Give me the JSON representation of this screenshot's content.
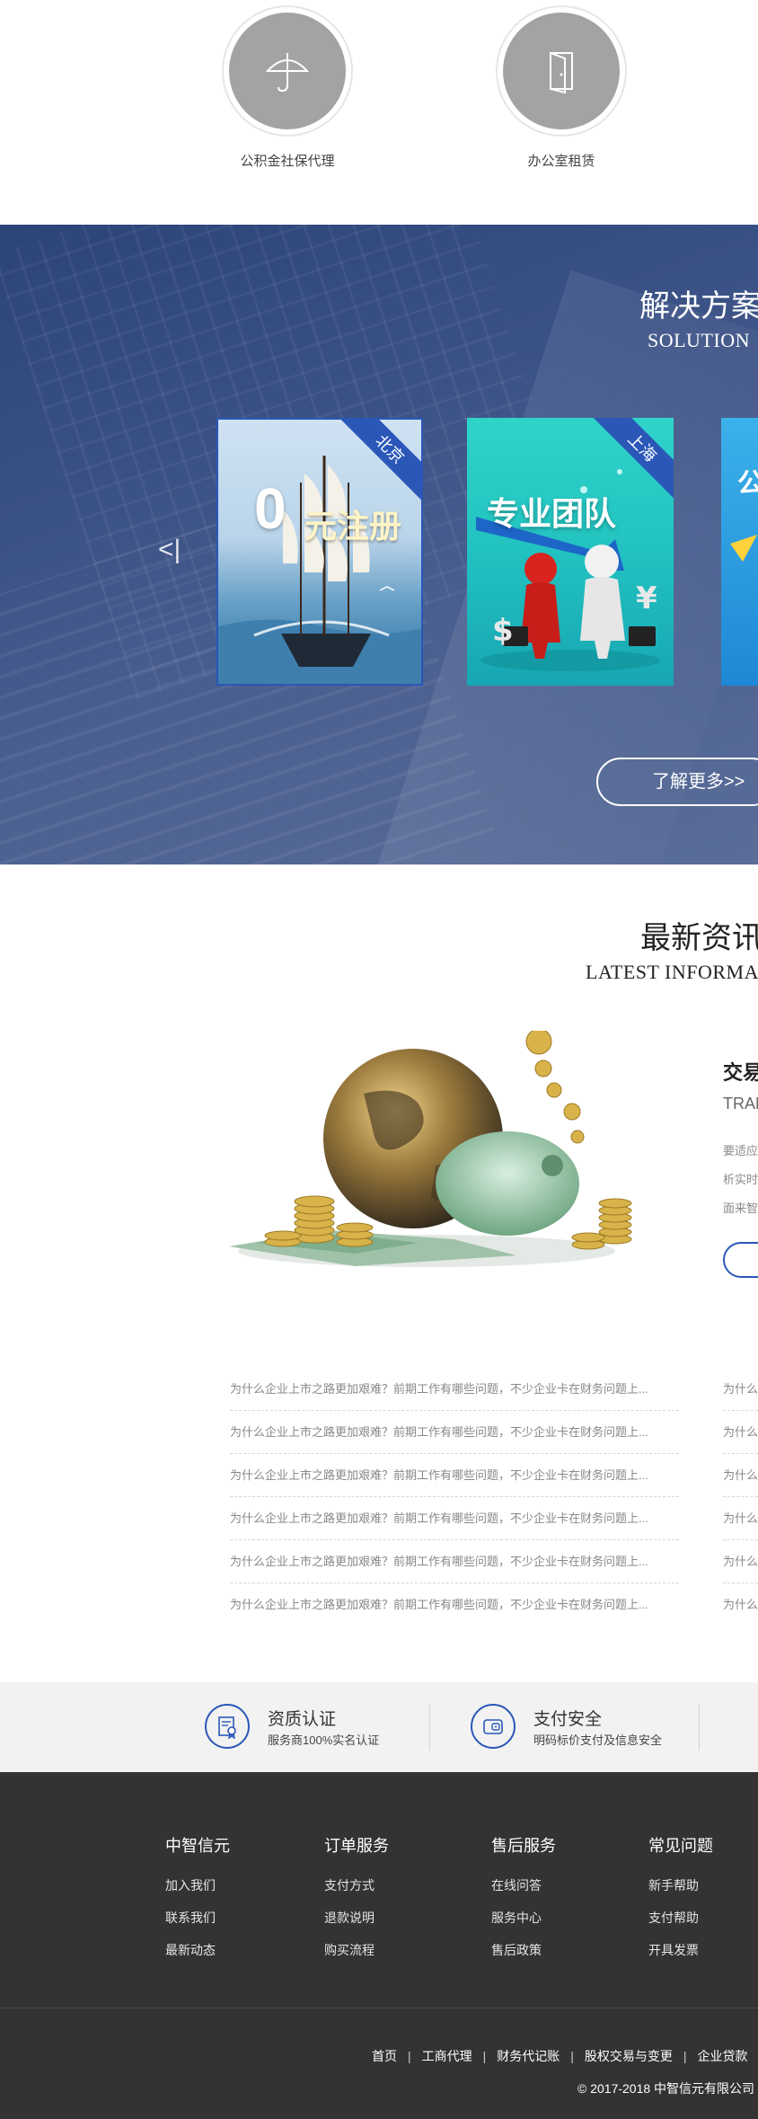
{
  "services": [
    {
      "label": "公积金社保代理",
      "icon": "umbrella-icon"
    },
    {
      "label": "办公室租赁",
      "icon": "door-icon"
    }
  ],
  "solution": {
    "title_cn": "解决方案",
    "title_en": "SOLUTION",
    "prev_label": "<|",
    "cards": [
      {
        "city": "北京",
        "text_big": "0",
        "text_main": "元注册"
      },
      {
        "city": "上海",
        "text_main": "专业团队"
      },
      {
        "text_main": "公"
      }
    ],
    "more_label": "了解更多>>"
  },
  "news": {
    "title_cn": "最新资讯",
    "title_en": "LATEST INFORMA",
    "feature": {
      "title": "交易",
      "subtitle": "TRAN",
      "lines": [
        "要适应",
        "析实时",
        "面来智"
      ]
    },
    "items": [
      "为什么企业上市之路更加艰难？前期工作有哪些问题，不少企业卡在财务问题上...",
      "为什么企业上市之路更加艰难？前期工作有哪些问题，不少企业卡在财务问题上...",
      "为什么企业上市之路更加艰难？前期工作有哪些问题，不少企业卡在财务问题上...",
      "为什么企业上市之路更加艰难？前期工作有哪些问题，不少企业卡在财务问题上...",
      "为什么企业上市之路更加艰难？前期工作有哪些问题，不少企业卡在财务问题上...",
      "为什么企业上市之路更加艰难？前期工作有哪些问题，不少企业卡在财务问题上..."
    ],
    "items_right": [
      "为什么",
      "为什么",
      "为什么",
      "为什么",
      "为什么",
      "为什么"
    ]
  },
  "trust": [
    {
      "title": "资质认证",
      "desc": "服务商100%实名认证",
      "icon": "certificate-icon"
    },
    {
      "title": "支付安全",
      "desc": "明码标价支付及信息安全",
      "icon": "wallet-icon"
    }
  ],
  "footer": {
    "columns": [
      {
        "heading": "中智信元",
        "links": [
          "加入我们",
          "联系我们",
          "最新动态"
        ]
      },
      {
        "heading": "订单服务",
        "links": [
          "支付方式",
          "退款说明",
          "购买流程"
        ]
      },
      {
        "heading": "售后服务",
        "links": [
          "在线问答",
          "服务中心",
          "售后政策"
        ]
      },
      {
        "heading": "常见问题",
        "links": [
          "新手帮助",
          "支付帮助",
          "开具发票"
        ]
      }
    ],
    "nav": [
      "首页",
      "工商代理",
      "财务代记账",
      "股权交易与变更",
      "企业贷款"
    ],
    "copyright": "© 2017-2018 中智信元有限公司"
  },
  "colors": {
    "accent": "#2a57b8",
    "footer_bg": "#333333",
    "trust_bg": "#f2f2f2",
    "service_disc": "#a3a3a3"
  }
}
